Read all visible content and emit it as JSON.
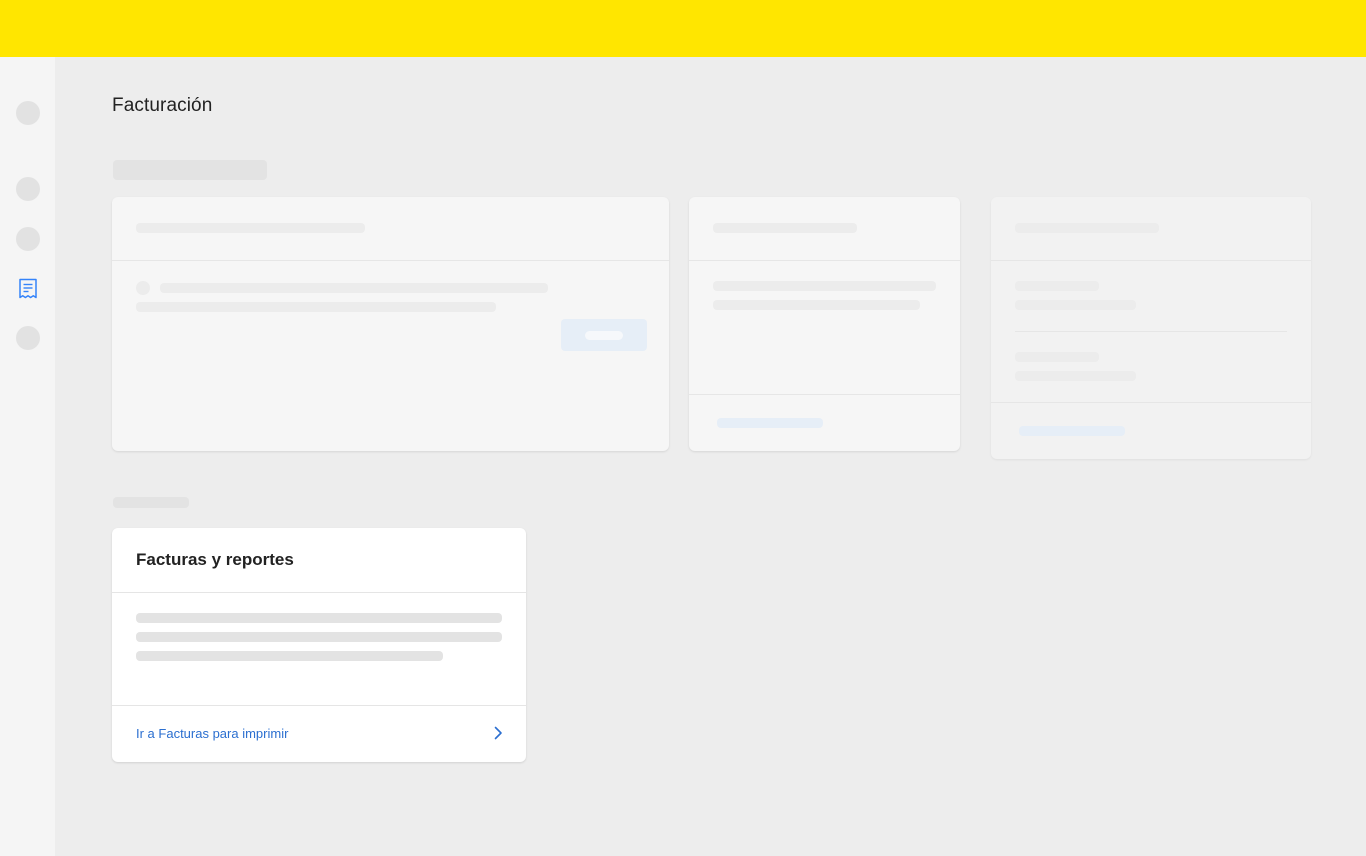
{
  "page": {
    "title": "Facturación"
  },
  "sidebar": {
    "active_icon": "receipt-icon",
    "accent_color": "#3483fa"
  },
  "invoices_card": {
    "title": "Facturas y reportes",
    "link_label": "Ir a Facturas para imprimir",
    "link_icon": "chevron-right-icon"
  },
  "colors": {
    "topbar": "#ffe600",
    "link": "#2b6fd0"
  }
}
